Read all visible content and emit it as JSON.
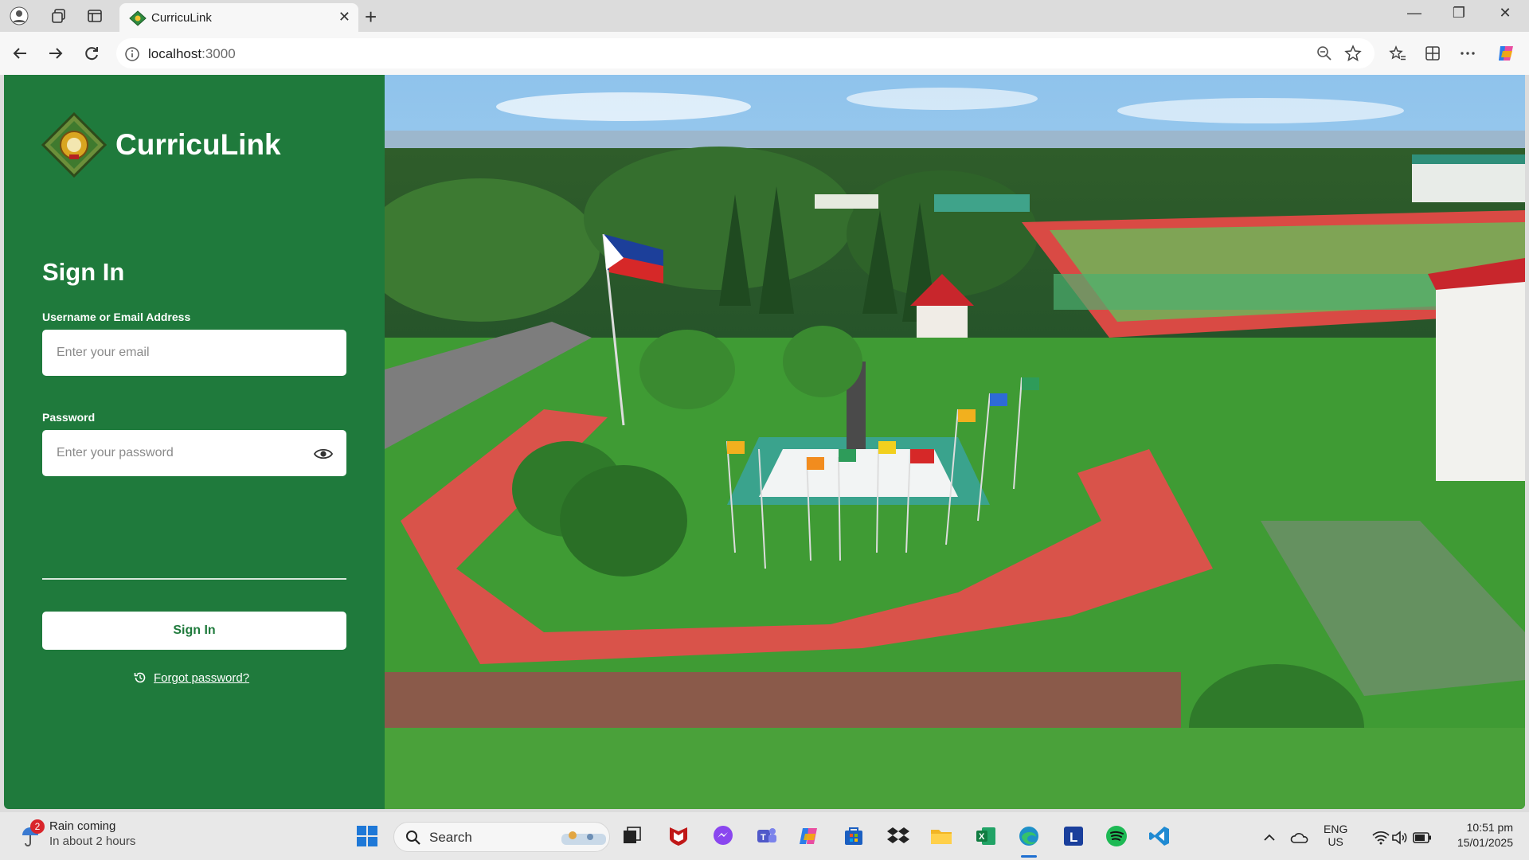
{
  "browser": {
    "tab_title": "CurricuLink",
    "url_host": "localhost",
    "url_port": ":3000"
  },
  "app": {
    "brand_name": "CurricuLink",
    "heading": "Sign In",
    "username_label": "Username or Email Address",
    "username_placeholder": "Enter your email",
    "password_label": "Password",
    "password_placeholder": "Enter your password",
    "submit_label": "Sign In",
    "forgot_label": "Forgot password?",
    "theme_color": "#1f7a3c"
  },
  "taskbar": {
    "weather_title": "Rain coming",
    "weather_sub": "In about 2 hours",
    "weather_badge": "2",
    "search_label": "Search",
    "lang": "ENG",
    "region": "US",
    "time": "10:51 pm",
    "date": "15/01/2025"
  }
}
